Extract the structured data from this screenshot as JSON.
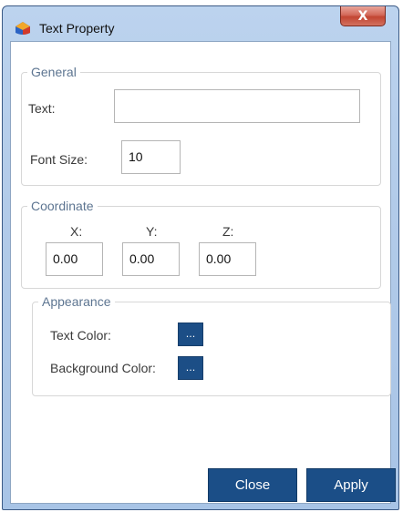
{
  "window": {
    "title": "Text Property",
    "close_glyph": "X",
    "icon": "app-icon"
  },
  "general": {
    "legend": "General",
    "text_label": "Text:",
    "text_value": "",
    "font_size_label": "Font Size:",
    "font_size_value": "10"
  },
  "coordinate": {
    "legend": "Coordinate",
    "x_label": "X:",
    "y_label": "Y:",
    "z_label": "Z:",
    "x_value": "0.00",
    "y_value": "0.00",
    "z_value": "0.00"
  },
  "appearance": {
    "legend": "Appearance",
    "text_color_label": "Text Color:",
    "background_color_label": "Background Color:",
    "color_button_label": "..."
  },
  "buttons": {
    "close": "Close",
    "apply": "Apply"
  },
  "colors": {
    "button_blue": "#1b4e87",
    "title_gradient": "#b2cbe9",
    "close_red": "#c24532"
  }
}
